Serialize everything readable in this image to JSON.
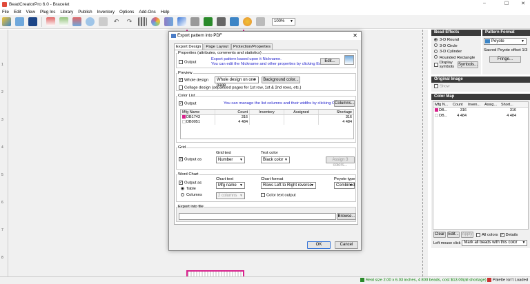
{
  "app": {
    "title": "BeadCreatorPro 6.0 - Bracelet",
    "menu": [
      "File",
      "Edit",
      "View",
      "Plug Ins",
      "Library",
      "Publish",
      "Inventory",
      "Options",
      "Add-Ons",
      "Help"
    ],
    "zoom": "100%"
  },
  "window_controls": {
    "minimize": "–",
    "maximize": "☐",
    "close": "✕"
  },
  "ruler": {
    "numbers": [
      "1",
      "2",
      "3",
      "4",
      "5",
      "6",
      "7",
      "8",
      "9"
    ]
  },
  "statusbar": {
    "info": "Real size 2.00 x 6.03 inches, 4 800 beads, cost $13.00(all shortage)",
    "palette": "Palette Isn't Loaded"
  },
  "bead_effects": {
    "header": "Bead Effects",
    "options": [
      "3-D Round",
      "3-D Circle",
      "3-D Cylinder",
      "Rounded Rectangle"
    ],
    "selected": "3-D Round",
    "display_symbols": "Display symbols",
    "symbols_button": "Symbols..."
  },
  "pattern_format": {
    "header": "Pattern Format",
    "value": "Peyote",
    "sacred_label": "Sacred Peyote offset 1/3",
    "fringe_button": "Fringe..."
  },
  "original_image": {
    "header": "Original Image",
    "show_label": "Show"
  },
  "color_map": {
    "header": "Color Map",
    "columns": [
      "Mfg N...",
      "Count",
      "Inven...",
      "Assig...",
      "Short..."
    ],
    "rows": [
      {
        "mfg": "DB...",
        "count": "316",
        "inventory": "",
        "assigned": "",
        "shortage": "316",
        "color": "#d8208c"
      },
      {
        "mfg": "DB...",
        "count": "4 484",
        "inventory": "",
        "assigned": "",
        "shortage": "4 484",
        "color": "#ffffff"
      }
    ],
    "clear": "Clear",
    "edit": "Edit...",
    "apply": "Apply",
    "all_colors": "All colors",
    "details": "Details",
    "left_click_label": "Left mouse click",
    "left_click_value": "Mark all beads with this color"
  },
  "dialog": {
    "title": "Export pattern into PDF",
    "tabs": [
      "Export Design",
      "Page Layout",
      "Protection/Properties"
    ],
    "properties": {
      "label": "Properties (attributes, comments and statistics)",
      "output": "Output",
      "info1": "Export pattern based upon it Nickname.",
      "info2": "You can edit the Nickname and other properties by clicking Edit.",
      "edit_button": "Edit..."
    },
    "preview": {
      "label": "Preview",
      "whole_design": "Whole design",
      "whole_design_option": "Whole design on one page",
      "background_button": "Background color...",
      "collage": "Collage design (separated pages for 1st row, 1st & 2nd rows, etc.)"
    },
    "color_list": {
      "label": "Color List",
      "output": "Output",
      "info": "You can manage the list columns and their widths by clicking Columns.",
      "columns_button": "Columns...",
      "columns": [
        "Mfg Name",
        "Count",
        "Inventory",
        "Assigned",
        "Shortage"
      ],
      "rows": [
        {
          "mfg": "DB1743",
          "count": "316",
          "inventory": "",
          "assigned": "",
          "shortage": "316",
          "color": "#d8208c"
        },
        {
          "mfg": "DB0051",
          "count": "4 484",
          "inventory": "",
          "assigned": "",
          "shortage": "4 484",
          "color": "#ffffff"
        }
      ]
    },
    "grid": {
      "label": "Grid",
      "output_as": "Output as",
      "grid_text_label": "Grid text",
      "grid_text_value": "Number",
      "text_color_label": "Text color",
      "text_color_value": "Black color",
      "assign_button": "Assign 3 colors..."
    },
    "word_chart": {
      "label": "Word Chart",
      "output_as": "Output as",
      "table": "Table",
      "columns": "Columns",
      "chart_text_label": "Chart text",
      "chart_text_value": "Mfg name",
      "columns_value": "2 columns",
      "chart_format_label": "Chart format",
      "chart_format_value": "Rows Left to Right reverse",
      "color_text_output": "Color text output",
      "peyote_type_label": "Peyote type",
      "peyote_type_value": "Combined"
    },
    "export_file": {
      "label": "Export into file",
      "path": "",
      "browse": "Browse..."
    },
    "ok": "OK",
    "cancel": "Cancel"
  }
}
